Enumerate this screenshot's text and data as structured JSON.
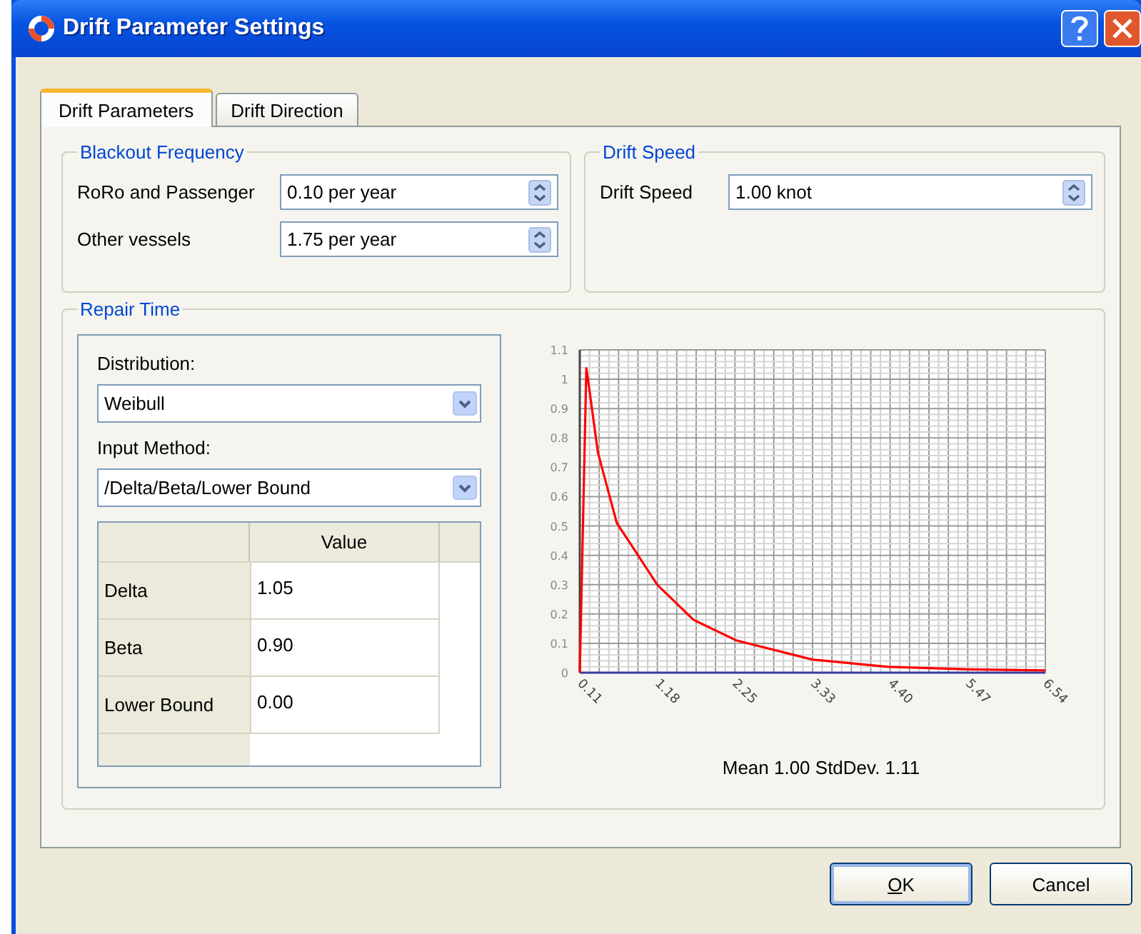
{
  "window": {
    "title": "Drift Parameter Settings"
  },
  "tabs": [
    {
      "label": "Drift Parameters",
      "selected": true
    },
    {
      "label": "Drift Direction",
      "selected": false
    }
  ],
  "blackout_frequency": {
    "title": "Blackout Frequency",
    "fields": [
      {
        "label": "RoRo and Passenger",
        "value": "0.10 per year"
      },
      {
        "label": "Other vessels",
        "value": "1.75 per year"
      }
    ]
  },
  "drift_speed": {
    "title": "Drift Speed",
    "fields": [
      {
        "label": "Drift Speed",
        "value": "1.00 knot"
      }
    ]
  },
  "repair_time": {
    "title": "Repair Time",
    "distribution_label": "Distribution:",
    "distribution_value": "Weibull",
    "input_method_label": "Input Method:",
    "input_method_value": "/Delta/Beta/Lower Bound",
    "table": {
      "columns": [
        "Value"
      ],
      "rows": [
        {
          "label": "Delta",
          "value": "1.05"
        },
        {
          "label": "Beta",
          "value": "0.90"
        },
        {
          "label": "Lower Bound",
          "value": "0.00"
        }
      ]
    },
    "chart_data": {
      "type": "line",
      "x": [
        0.11,
        0.2,
        0.36,
        0.62,
        0.89,
        1.18,
        1.68,
        2.27,
        3.32,
        4.37,
        5.49,
        6.54
      ],
      "series": [
        {
          "color": "#ff0000",
          "values": [
            0,
            1.04,
            0.75,
            0.51,
            0.41,
            0.3,
            0.18,
            0.11,
            0.045,
            0.02,
            0.011,
            0.008
          ]
        }
      ],
      "xlim": [
        0.11,
        6.54
      ],
      "ylim": [
        0,
        1.1
      ],
      "xticks": [
        {
          "value": 0.11,
          "label": "0.11"
        },
        {
          "value": 1.18,
          "label": "1.18"
        },
        {
          "value": 2.25,
          "label": "2.25"
        },
        {
          "value": 3.33,
          "label": "3.33"
        },
        {
          "value": 4.4,
          "label": "4.40"
        },
        {
          "value": 5.47,
          "label": "5.47"
        },
        {
          "value": 6.54,
          "label": "6.54"
        }
      ],
      "yticks": [
        0,
        0.1,
        0.2,
        0.3,
        0.4,
        0.5,
        0.6,
        0.7,
        0.8,
        0.9,
        1,
        1.1
      ],
      "grid": true
    },
    "summary": "Mean 1.00 StdDev. 1.11"
  },
  "buttons": [
    {
      "label": "OK",
      "default": true
    },
    {
      "label": "Cancel",
      "default": false
    }
  ]
}
